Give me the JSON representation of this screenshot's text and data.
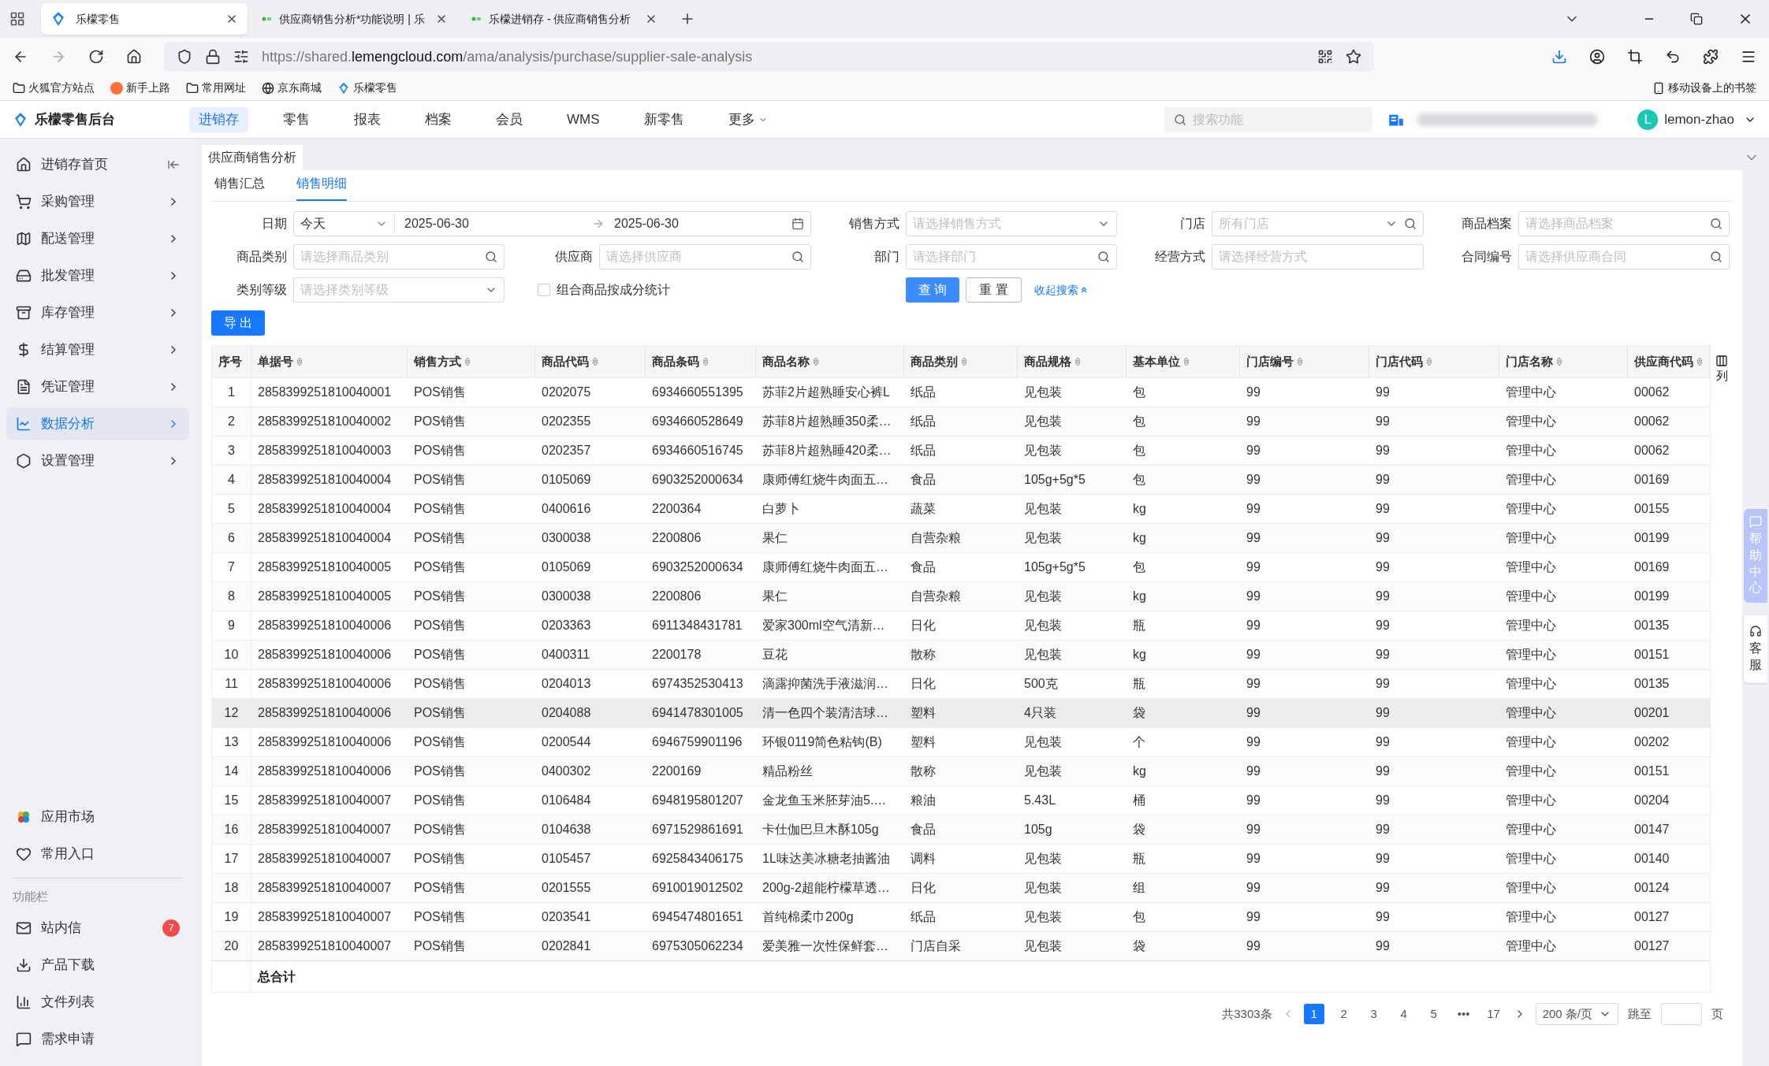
{
  "browser": {
    "tabs": [
      {
        "title": "乐檬零售",
        "selected": true
      },
      {
        "title": "供应商销售分析*功能说明 | 乐",
        "selected": false
      },
      {
        "title": "乐檬进销存 - 供应商销售分析",
        "selected": false
      }
    ],
    "url": {
      "before": "https://shared.",
      "host": "lemengcloud.com",
      "after": "/ama/analysis/purchase/supplier-sale-analysis"
    },
    "bookmarks": [
      "火狐官方站点",
      "新手上路",
      "常用网址",
      "京东商城",
      "乐檬零售"
    ],
    "mobile_bookmarks": "移动设备上的书签"
  },
  "app": {
    "logo": "乐檬零售后台",
    "nav": [
      {
        "label": "进销存",
        "selected": true
      },
      {
        "label": "零售",
        "selected": false
      },
      {
        "label": "报表",
        "selected": false
      },
      {
        "label": "档案",
        "selected": false
      },
      {
        "label": "会员",
        "selected": false
      },
      {
        "label": "WMS",
        "selected": false
      },
      {
        "label": "新零售",
        "selected": false
      },
      {
        "label": "更多",
        "selected": false
      }
    ],
    "search": {
      "placeholder": "搜索功能"
    },
    "user": {
      "initial": "L",
      "name": "lemon-zhao"
    }
  },
  "sidebar": {
    "items": [
      {
        "label": "进销存首页",
        "selected": false
      },
      {
        "label": "采购管理",
        "selected": false
      },
      {
        "label": "配送管理",
        "selected": false
      },
      {
        "label": "批发管理",
        "selected": false
      },
      {
        "label": "库存管理",
        "selected": false
      },
      {
        "label": "结算管理",
        "selected": false
      },
      {
        "label": "凭证管理",
        "selected": false
      },
      {
        "label": "数据分析",
        "selected": true
      },
      {
        "label": "设置管理",
        "selected": false
      }
    ],
    "bottom_items": [
      {
        "label": "应用市场"
      },
      {
        "label": "常用入口"
      }
    ],
    "section_label": "功能栏",
    "tools": [
      {
        "label": "站内信",
        "badge": "7"
      },
      {
        "label": "产品下载"
      },
      {
        "label": "文件列表"
      },
      {
        "label": "需求申请"
      }
    ]
  },
  "page_tab": "供应商销售分析",
  "subtabs": [
    {
      "label": "销售汇总",
      "selected": false
    },
    {
      "label": "销售明细",
      "selected": true
    }
  ],
  "filters": [
    [
      {
        "kind": "date_range",
        "label": "日期",
        "preset": "今天",
        "start": "2025-06-30",
        "end": "2025-06-30"
      },
      {
        "kind": "select",
        "label": "销售方式",
        "placeholder": "请选择销售方式"
      },
      {
        "kind": "select_search",
        "label": "门店",
        "placeholder": "所有门店"
      },
      {
        "kind": "search",
        "label": "商品档案",
        "placeholder": "请选择商品档案"
      }
    ],
    [
      {
        "kind": "search",
        "label": "商品类别",
        "placeholder": "请选择商品类别"
      },
      {
        "kind": "search",
        "label": "供应商",
        "placeholder": "请选择供应商"
      },
      {
        "kind": "search",
        "label": "部门",
        "placeholder": "请选择部门"
      },
      {
        "kind": "text",
        "label": "经营方式",
        "placeholder": "请选择经营方式"
      },
      {
        "kind": "search",
        "label": "合同编号",
        "placeholder": "请选择供应商合同"
      }
    ],
    [
      {
        "kind": "select",
        "label": "类别等级",
        "placeholder": "请选择类别等级"
      },
      {
        "kind": "checkbox",
        "label": "组合商品按成分统计",
        "checked": false
      },
      {
        "kind": "actions",
        "query": "查 询",
        "reset": "重 置",
        "collapse": "收起搜索"
      }
    ]
  ],
  "export_button": "导 出",
  "table": {
    "columns": [
      {
        "label": "序号",
        "sortable": false
      },
      {
        "label": "单据号",
        "sortable": true
      },
      {
        "label": "销售方式",
        "sortable": true
      },
      {
        "label": "商品代码",
        "sortable": true
      },
      {
        "label": "商品条码",
        "sortable": true
      },
      {
        "label": "商品名称",
        "sortable": true
      },
      {
        "label": "商品类别",
        "sortable": true
      },
      {
        "label": "商品规格",
        "sortable": true
      },
      {
        "label": "基本单位",
        "sortable": true
      },
      {
        "label": "门店编号",
        "sortable": true
      },
      {
        "label": "门店代码",
        "sortable": true
      },
      {
        "label": "门店名称",
        "sortable": true
      },
      {
        "label": "供应商代码",
        "sortable": true
      }
    ],
    "column_toggle": "列",
    "rows": [
      {
        "highlighted": false,
        "cells": [
          "1",
          "2858399251810040001",
          "POS销售",
          "0202075",
          "6934660551395",
          "苏菲2片超熟睡安心裤L",
          "纸品",
          "见包装",
          "包",
          "99",
          "99",
          "管理中心",
          "00062"
        ]
      },
      {
        "highlighted": false,
        "cells": [
          "2",
          "2858399251810040002",
          "POS销售",
          "0202355",
          "6934660528649",
          "苏菲8片超熟睡350柔…",
          "纸品",
          "见包装",
          "包",
          "99",
          "99",
          "管理中心",
          "00062"
        ]
      },
      {
        "highlighted": false,
        "cells": [
          "3",
          "2858399251810040003",
          "POS销售",
          "0202357",
          "6934660516745",
          "苏菲8片超熟睡420柔…",
          "纸品",
          "见包装",
          "包",
          "99",
          "99",
          "管理中心",
          "00062"
        ]
      },
      {
        "highlighted": false,
        "cells": [
          "4",
          "2858399251810040004",
          "POS销售",
          "0105069",
          "6903252000634",
          "康师傅红烧牛肉面五…",
          "食品",
          "105g+5g*5",
          "包",
          "99",
          "99",
          "管理中心",
          "00169"
        ]
      },
      {
        "highlighted": false,
        "cells": [
          "5",
          "2858399251810040004",
          "POS销售",
          "0400616",
          "2200364",
          "白萝卜",
          "蔬菜",
          "见包装",
          "kg",
          "99",
          "99",
          "管理中心",
          "00155"
        ]
      },
      {
        "highlighted": false,
        "cells": [
          "6",
          "2858399251810040004",
          "POS销售",
          "0300038",
          "2200806",
          "果仁",
          "自营杂粮",
          "见包装",
          "kg",
          "99",
          "99",
          "管理中心",
          "00199"
        ]
      },
      {
        "highlighted": false,
        "cells": [
          "7",
          "2858399251810040005",
          "POS销售",
          "0105069",
          "6903252000634",
          "康师傅红烧牛肉面五…",
          "食品",
          "105g+5g*5",
          "包",
          "99",
          "99",
          "管理中心",
          "00169"
        ]
      },
      {
        "highlighted": false,
        "cells": [
          "8",
          "2858399251810040005",
          "POS销售",
          "0300038",
          "2200806",
          "果仁",
          "自营杂粮",
          "见包装",
          "kg",
          "99",
          "99",
          "管理中心",
          "00199"
        ]
      },
      {
        "highlighted": false,
        "cells": [
          "9",
          "2858399251810040006",
          "POS销售",
          "0203363",
          "6911348431781",
          "爱家300ml空气清新…",
          "日化",
          "见包装",
          "瓶",
          "99",
          "99",
          "管理中心",
          "00135"
        ]
      },
      {
        "highlighted": false,
        "cells": [
          "10",
          "2858399251810040006",
          "POS销售",
          "0400311",
          "2200178",
          "豆花",
          "散称",
          "见包装",
          "kg",
          "99",
          "99",
          "管理中心",
          "00151"
        ]
      },
      {
        "highlighted": false,
        "cells": [
          "11",
          "2858399251810040006",
          "POS销售",
          "0204013",
          "6974352530413",
          "滴露抑菌洗手液滋润…",
          "日化",
          "500克",
          "瓶",
          "99",
          "99",
          "管理中心",
          "00135"
        ]
      },
      {
        "highlighted": true,
        "cells": [
          "12",
          "2858399251810040006",
          "POS销售",
          "0204088",
          "6941478301005",
          "清一色四个装清洁球…",
          "塑料",
          "4只装",
          "袋",
          "99",
          "99",
          "管理中心",
          "00201"
        ]
      },
      {
        "highlighted": false,
        "cells": [
          "13",
          "2858399251810040006",
          "POS销售",
          "0200544",
          "6946759901196",
          "环银0119简色粘钩(B)",
          "塑料",
          "见包装",
          "个",
          "99",
          "99",
          "管理中心",
          "00202"
        ]
      },
      {
        "highlighted": false,
        "cells": [
          "14",
          "2858399251810040006",
          "POS销售",
          "0400302",
          "2200169",
          "精品粉丝",
          "散称",
          "见包装",
          "kg",
          "99",
          "99",
          "管理中心",
          "00151"
        ]
      },
      {
        "highlighted": false,
        "cells": [
          "15",
          "2858399251810040007",
          "POS销售",
          "0106484",
          "6948195801207",
          "金龙鱼玉米胚芽油5.…",
          "粮油",
          "5.43L",
          "桶",
          "99",
          "99",
          "管理中心",
          "00204"
        ]
      },
      {
        "highlighted": false,
        "cells": [
          "16",
          "2858399251810040007",
          "POS销售",
          "0104638",
          "6971529861691",
          "卡仕伽巴旦木酥105g",
          "食品",
          "105g",
          "袋",
          "99",
          "99",
          "管理中心",
          "00147"
        ]
      },
      {
        "highlighted": false,
        "cells": [
          "17",
          "2858399251810040007",
          "POS销售",
          "0105457",
          "6925843406175",
          "1L味达美冰糖老抽酱油",
          "调料",
          "见包装",
          "瓶",
          "99",
          "99",
          "管理中心",
          "00140"
        ]
      },
      {
        "highlighted": false,
        "cells": [
          "18",
          "2858399251810040007",
          "POS销售",
          "0201555",
          "6910019012502",
          "200g-2超能柠檬草透…",
          "日化",
          "见包装",
          "组",
          "99",
          "99",
          "管理中心",
          "00124"
        ]
      },
      {
        "highlighted": false,
        "cells": [
          "19",
          "2858399251810040007",
          "POS销售",
          "0203541",
          "6945474801651",
          "首纯棉柔巾200g",
          "纸品",
          "见包装",
          "包",
          "99",
          "99",
          "管理中心",
          "00127"
        ]
      },
      {
        "highlighted": false,
        "cells": [
          "20",
          "2858399251810040007",
          "POS销售",
          "0202841",
          "6975305062234",
          "爱美雅一次性保鲜套…",
          "门店自采",
          "见包装",
          "袋",
          "99",
          "99",
          "管理中心",
          "00127"
        ]
      }
    ],
    "total_label": "总合计"
  },
  "pagination": {
    "total": "共3303条",
    "pages": [
      {
        "label": "1",
        "selected": true
      },
      {
        "label": "2",
        "selected": false
      },
      {
        "label": "3",
        "selected": false
      },
      {
        "label": "4",
        "selected": false
      },
      {
        "label": "5",
        "selected": false
      },
      {
        "label": "•••",
        "selected": false
      },
      {
        "label": "17",
        "selected": false
      }
    ],
    "page_size": "200 条/页",
    "jump_label": "跳至",
    "jump_suffix": "页"
  },
  "side_help": {
    "help": "帮助中心",
    "service": "客服"
  }
}
